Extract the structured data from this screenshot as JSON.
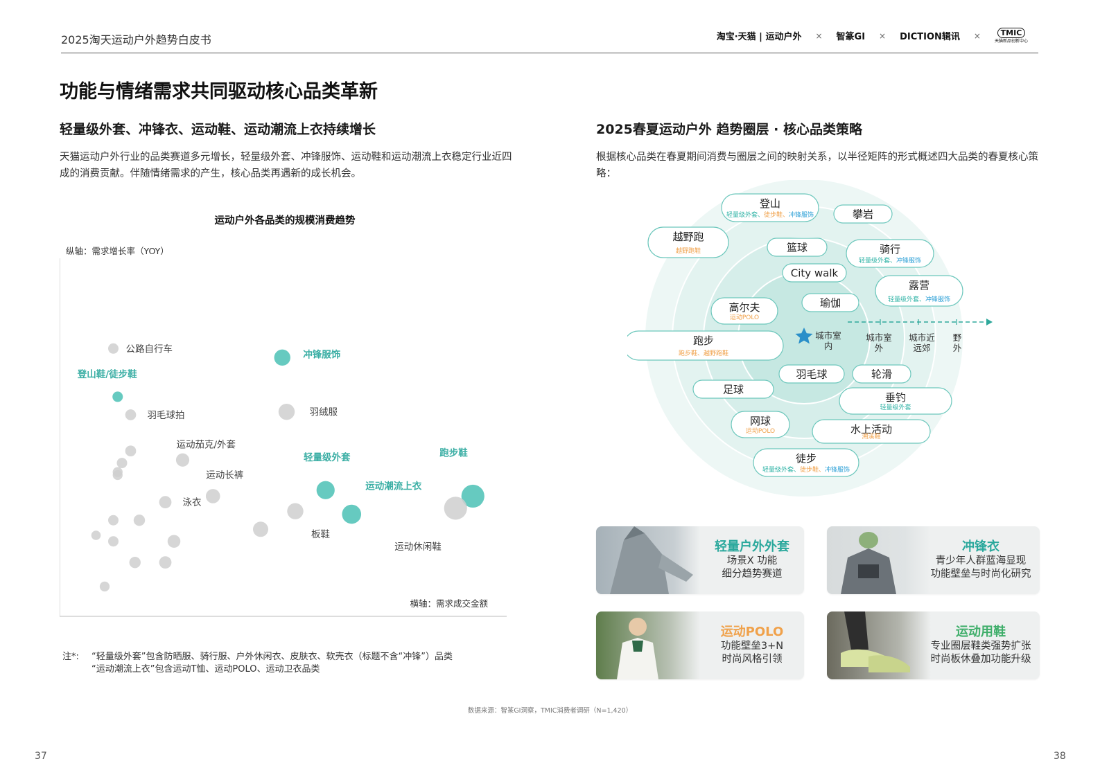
{
  "header": {
    "title": "2025淘天运动户外趋势白皮书",
    "logos": {
      "taobao": "淘宝·天猫 | 运动户外",
      "zhimeng": "智篆GI",
      "diction": "DICTION辑讯",
      "tmic_big": "TMIC",
      "tmic_small": "天猫新品创新中心",
      "separator": "×"
    }
  },
  "page_title": "功能与情绪需求共同驱动核心品类革新",
  "left": {
    "heading": "轻量级外套、冲锋衣、运动鞋、运动潮流上衣持续增长",
    "body": "天猫运动户外行业的品类赛道多元增长，轻量级外套、冲锋服饰、运动鞋和运动潮流上衣稳定行业近四成的消费贡献。伴随情绪需求的产生，核心品类再遇新的成长机会。"
  },
  "chart_data": {
    "type": "scatter",
    "title": "运动户外各品类的规模消费趋势",
    "ylabel": "纵轴：需求增长率（YOY）",
    "xlabel": "横轴：需求成交金额",
    "colors": {
      "highlight": "#5ec7bd",
      "muted": "#cfcfcf",
      "highlight_label": "#3aaea4"
    },
    "points": [
      {
        "label": "公路自行车",
        "x": 0.1,
        "y": 0.82,
        "size": 0.1,
        "highlight": false
      },
      {
        "label": "冲锋服饰",
        "x": 0.49,
        "y": 0.79,
        "size": 0.22,
        "highlight": true
      },
      {
        "label": "登山鞋/徒步鞋",
        "x": 0.11,
        "y": 0.66,
        "size": 0.1,
        "highlight": true
      },
      {
        "label": "羽毛球拍",
        "x": 0.14,
        "y": 0.6,
        "size": 0.11,
        "highlight": false
      },
      {
        "label": "羽绒服",
        "x": 0.5,
        "y": 0.61,
        "size": 0.22,
        "highlight": false
      },
      {
        "label": "运动茄克/外套",
        "x": 0.26,
        "y": 0.45,
        "size": 0.16,
        "highlight": false
      },
      {
        "label": "",
        "x": 0.14,
        "y": 0.48,
        "size": 0.11,
        "highlight": false
      },
      {
        "label": "",
        "x": 0.12,
        "y": 0.44,
        "size": 0.1,
        "highlight": false
      },
      {
        "label": "",
        "x": 0.11,
        "y": 0.41,
        "size": 0.09,
        "highlight": false
      },
      {
        "label": "",
        "x": 0.11,
        "y": 0.4,
        "size": 0.09,
        "highlight": false
      },
      {
        "label": "运动长裤",
        "x": 0.33,
        "y": 0.33,
        "size": 0.18,
        "highlight": false
      },
      {
        "label": "泳衣",
        "x": 0.22,
        "y": 0.31,
        "size": 0.14,
        "highlight": false
      },
      {
        "label": "轻量级外套",
        "x": 0.59,
        "y": 0.35,
        "size": 0.26,
        "highlight": true
      },
      {
        "label": "运动潮流上衣",
        "x": 0.65,
        "y": 0.27,
        "size": 0.28,
        "highlight": true
      },
      {
        "label": "板鞋",
        "x": 0.52,
        "y": 0.28,
        "size": 0.22,
        "highlight": false
      },
      {
        "label": "",
        "x": 0.44,
        "y": 0.22,
        "size": 0.2,
        "highlight": false
      },
      {
        "label": "跑步鞋",
        "x": 0.93,
        "y": 0.33,
        "size": 0.36,
        "highlight": true
      },
      {
        "label": "运动休闲鞋",
        "x": 0.89,
        "y": 0.29,
        "size": 0.36,
        "highlight": false
      },
      {
        "label": "",
        "x": 0.1,
        "y": 0.25,
        "size": 0.1,
        "highlight": false
      },
      {
        "label": "",
        "x": 0.16,
        "y": 0.25,
        "size": 0.12,
        "highlight": false
      },
      {
        "label": "",
        "x": 0.06,
        "y": 0.2,
        "size": 0.08,
        "highlight": false
      },
      {
        "label": "",
        "x": 0.1,
        "y": 0.18,
        "size": 0.1,
        "highlight": false
      },
      {
        "label": "",
        "x": 0.24,
        "y": 0.18,
        "size": 0.15,
        "highlight": false
      },
      {
        "label": "",
        "x": 0.15,
        "y": 0.11,
        "size": 0.12,
        "highlight": false
      },
      {
        "label": "",
        "x": 0.22,
        "y": 0.11,
        "size": 0.14,
        "highlight": false
      },
      {
        "label": "",
        "x": 0.08,
        "y": 0.03,
        "size": 0.09,
        "highlight": false
      }
    ]
  },
  "note": {
    "label": "注*:",
    "line1": "“轻量级外套”包含防晒服、骑行服、户外休闲衣、皮肤衣、软壳衣（标题不含“冲锋”）品类",
    "line2": "“运动潮流上衣”包含运动T恤、运动POLO、运动卫衣品类"
  },
  "right": {
    "heading": "2025春夏运动户外 趋势圈层 · 核心品类策略",
    "body": "根据核心品类在春夏期间消费与圈层之间的映射关系，以半径矩阵的形式概述四大品类的春夏核心策略："
  },
  "circle_map": {
    "center_label": "城市室内",
    "ring_labels": [
      "城市室外",
      "城市近远郊",
      "野外"
    ],
    "colors": {
      "green": "#2fb3a6",
      "orange": "#f0a14a",
      "blue": "#2a9fd6"
    },
    "pills": [
      {
        "name": "登山",
        "tags": [
          [
            "轻量级外套、",
            "green"
          ],
          [
            "徒步鞋、",
            "orange"
          ],
          [
            "冲锋服饰",
            "blue"
          ]
        ]
      },
      {
        "name": "攀岩",
        "tags": []
      },
      {
        "name": "越野跑",
        "tags": [
          [
            "越野跑鞋",
            "orange"
          ]
        ]
      },
      {
        "name": "篮球",
        "tags": []
      },
      {
        "name": "骑行",
        "tags": [
          [
            "轻量级外套、",
            "green"
          ],
          [
            "冲锋服饰",
            "blue"
          ]
        ]
      },
      {
        "name": "City walk",
        "tags": []
      },
      {
        "name": "露营",
        "tags": [
          [
            "轻量级外套、",
            "green"
          ],
          [
            "冲锋服饰",
            "blue"
          ]
        ]
      },
      {
        "name": "高尔夫",
        "tags": [
          [
            "运动POLO",
            "orange"
          ]
        ]
      },
      {
        "name": "瑜伽",
        "tags": []
      },
      {
        "name": "跑步",
        "tags": [
          [
            "跑步鞋、越野跑鞋",
            "orange"
          ]
        ]
      },
      {
        "name": "羽毛球",
        "tags": []
      },
      {
        "name": "轮滑",
        "tags": []
      },
      {
        "name": "足球",
        "tags": []
      },
      {
        "name": "垂钓",
        "tags": [
          [
            "轻量级外套",
            "green"
          ]
        ]
      },
      {
        "name": "网球",
        "tags": [
          [
            "运动POLO",
            "orange"
          ]
        ]
      },
      {
        "name": "水上活动",
        "tags": [
          [
            "溯溪鞋",
            "orange"
          ]
        ]
      },
      {
        "name": "徒步",
        "tags": [
          [
            "轻量级外套、",
            "green"
          ],
          [
            "徒步鞋、",
            "orange"
          ],
          [
            "冲锋服饰",
            "blue"
          ]
        ]
      }
    ]
  },
  "cards": [
    {
      "title": "轻量户外外套",
      "line1": "场景X 功能",
      "line2": "细分趋势赛道",
      "color": "#2aa89c"
    },
    {
      "title": "冲锋衣",
      "line1": "青少年人群蓝海显现",
      "line2": "功能壁垒与时尚化研究",
      "color": "#2aa89c"
    },
    {
      "title": "运动POLO",
      "line1": "功能壁垒3+N",
      "line2": "时尚风格引领",
      "color": "#f0a14a"
    },
    {
      "title": "运动用鞋",
      "line1": "专业圈层鞋类强势扩张",
      "line2": "时尚板休叠加功能升级",
      "color": "#3fae6a"
    }
  ],
  "source": "数据来源：智篆GI洞察，TMIC消费者调研（N=1,420）",
  "page_numbers": {
    "left": "37",
    "right": "38"
  }
}
